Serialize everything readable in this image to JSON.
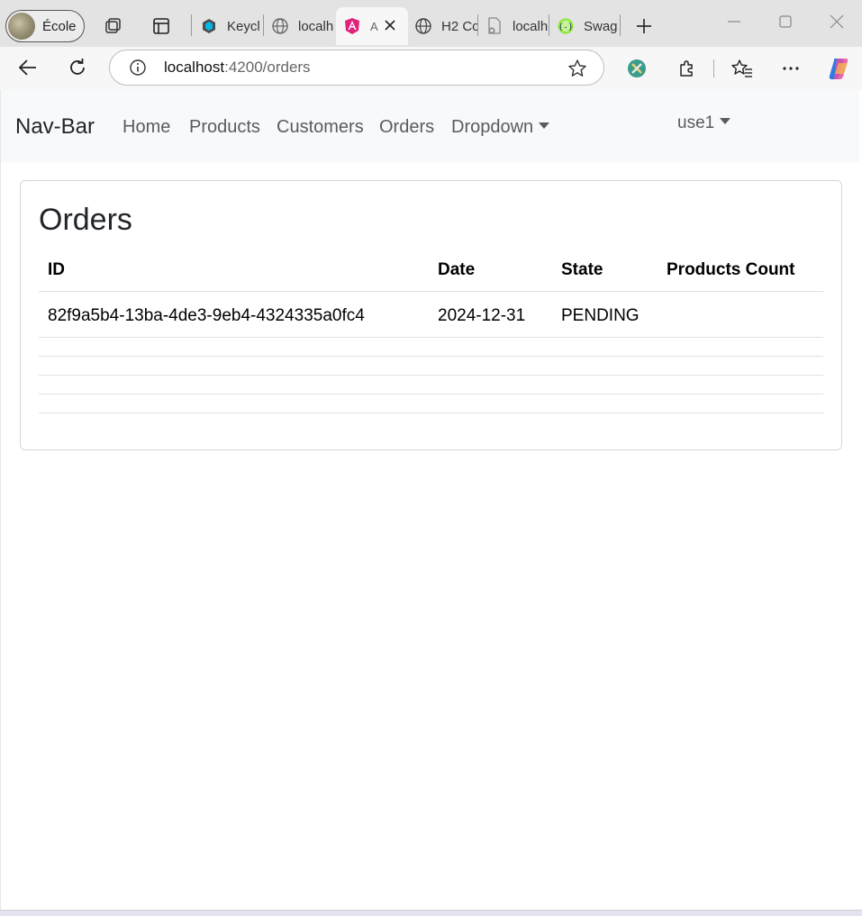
{
  "browser": {
    "profile_name": "École",
    "tabs": [
      {
        "label": "Keycl",
        "icon": "keycloak-icon"
      },
      {
        "label": "localh",
        "icon": "globe-icon"
      },
      {
        "label": "A",
        "icon": "angular-icon",
        "active": true
      },
      {
        "label": "H2 Co",
        "icon": "globe-icon"
      },
      {
        "label": "localh",
        "icon": "file-error-icon"
      },
      {
        "label": "Swag",
        "icon": "swagger-icon"
      }
    ],
    "url_host": "localhost",
    "url_path": ":4200/orders"
  },
  "navbar": {
    "brand": "Nav-Bar",
    "links": [
      "Home",
      "Products",
      "Customers",
      "Orders"
    ],
    "dropdown_label": "Dropdown",
    "user_label": "use1"
  },
  "orders": {
    "title": "Orders",
    "columns": [
      "ID",
      "Date",
      "State",
      "Products Count"
    ],
    "rows": [
      {
        "id": "82f9a5b4-13ba-4de3-9eb4-4324335a0fc4",
        "date": "2024-12-31",
        "state": "PENDING",
        "products_count": ""
      }
    ]
  },
  "colors": {
    "navbar_bg": "#f8f9fa",
    "nav_link": "#595c5f",
    "angular_accent": "#e0237a"
  }
}
